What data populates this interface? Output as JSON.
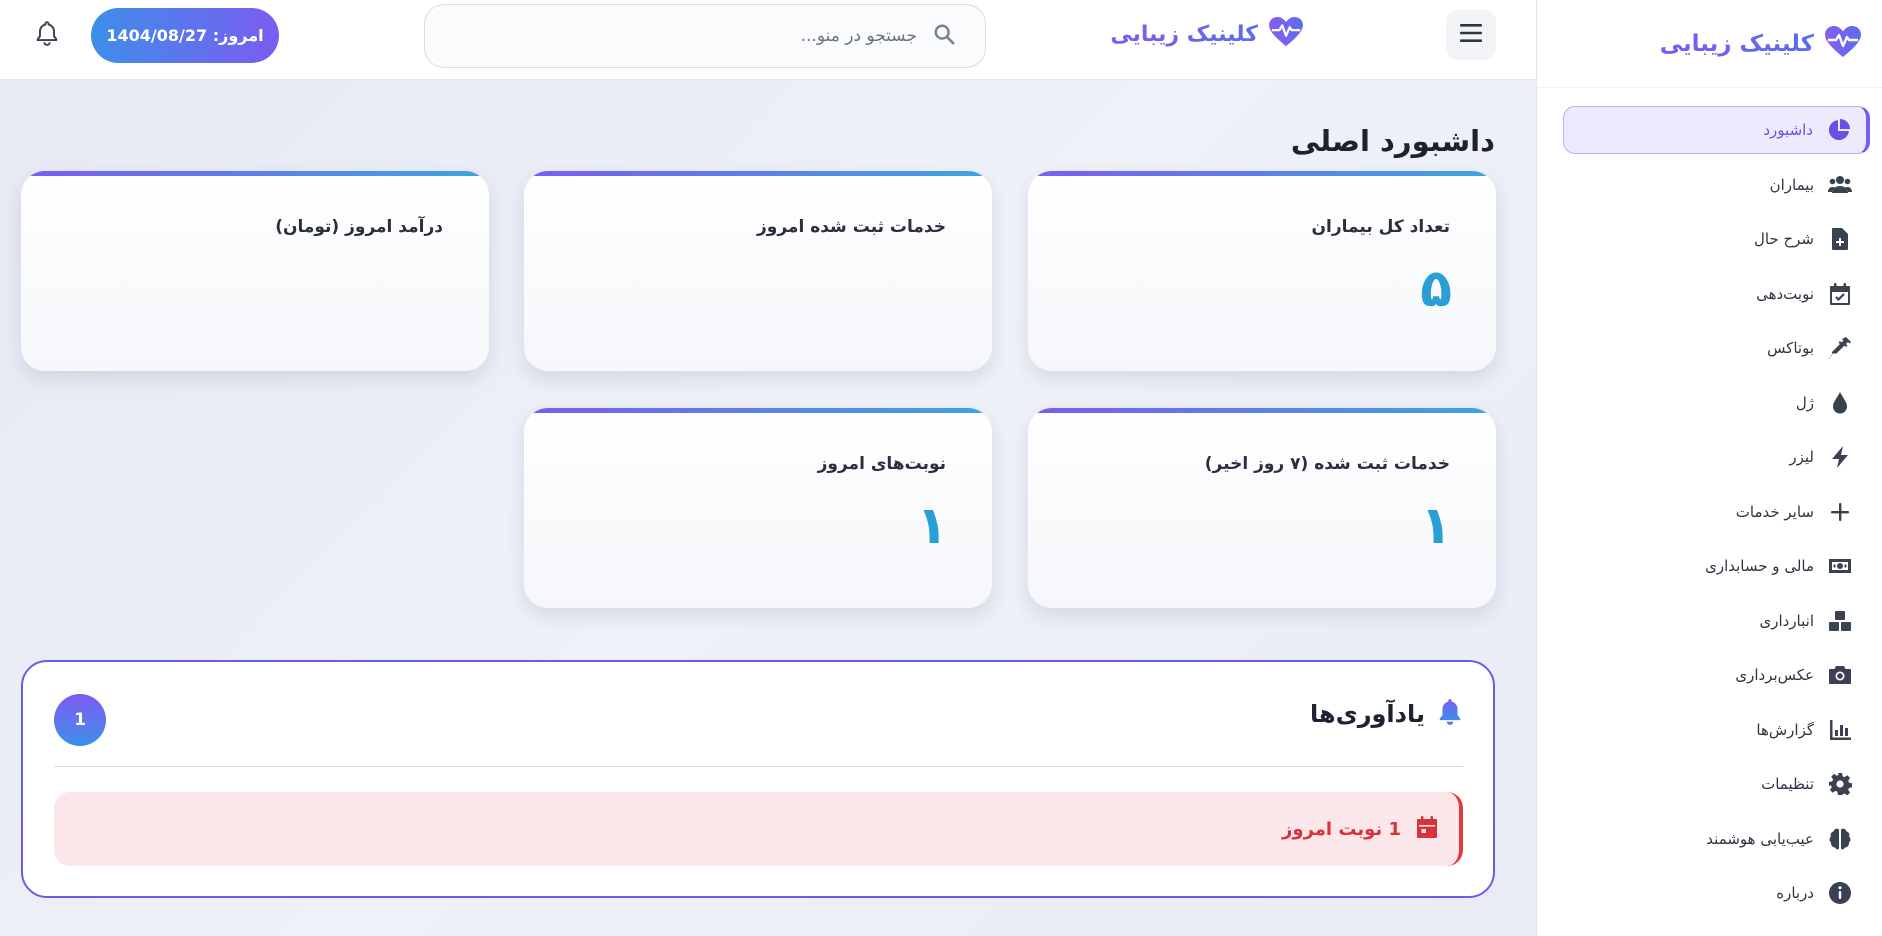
{
  "sidebar": {
    "brand": "کلینیک زیبایی",
    "items": [
      {
        "label": "داشبورد",
        "icon": "chart-pie-icon",
        "active": true
      },
      {
        "label": "بیماران",
        "icon": "users-icon"
      },
      {
        "label": "شرح حال",
        "icon": "file-medical-icon"
      },
      {
        "label": "نوبت‌دهی",
        "icon": "calendar-check-icon"
      },
      {
        "label": "بوتاکس",
        "icon": "syringe-icon"
      },
      {
        "label": "ژل",
        "icon": "droplet-icon"
      },
      {
        "label": "لیزر",
        "icon": "bolt-icon"
      },
      {
        "label": "سایر خدمات",
        "icon": "plus-icon"
      },
      {
        "label": "مالی و حسابداری",
        "icon": "money-icon"
      },
      {
        "label": "انبارداری",
        "icon": "boxes-icon"
      },
      {
        "label": "عکس‌برداری",
        "icon": "camera-icon"
      },
      {
        "label": "گزارش‌ها",
        "icon": "chart-bar-icon"
      },
      {
        "label": "تنظیمات",
        "icon": "gear-icon"
      },
      {
        "label": "عیب‌یابی هوشمند",
        "icon": "brain-icon"
      },
      {
        "label": "درباره",
        "icon": "info-icon"
      }
    ]
  },
  "header": {
    "brand": "کلینیک زیبایی",
    "search_placeholder": "جستجو در منو...",
    "date_label": "امروز: 1404/08/27"
  },
  "main": {
    "title": "داشبورد اصلی",
    "cards": [
      {
        "label": "تعداد کل بیماران",
        "value": "۵"
      },
      {
        "label": "خدمات ثبت شده امروز",
        "value": ""
      },
      {
        "label": "درآمد امروز (تومان)",
        "value": ""
      },
      {
        "label": "خدمات ثبت شده (۷ روز اخیر)",
        "value": "۱"
      },
      {
        "label": "نوبت‌های امروز",
        "value": "۱"
      }
    ]
  },
  "reminders": {
    "title": "یادآوری‌ها",
    "count": "1",
    "items": [
      {
        "text": "1 نوبت امروز"
      }
    ]
  },
  "colors": {
    "accent": "#7b5cf1",
    "accent_blue": "#3e8ee9",
    "stat_value": "#2a9fd6",
    "alert_red": "#d8333a",
    "alert_bg": "#fbe7e9"
  }
}
